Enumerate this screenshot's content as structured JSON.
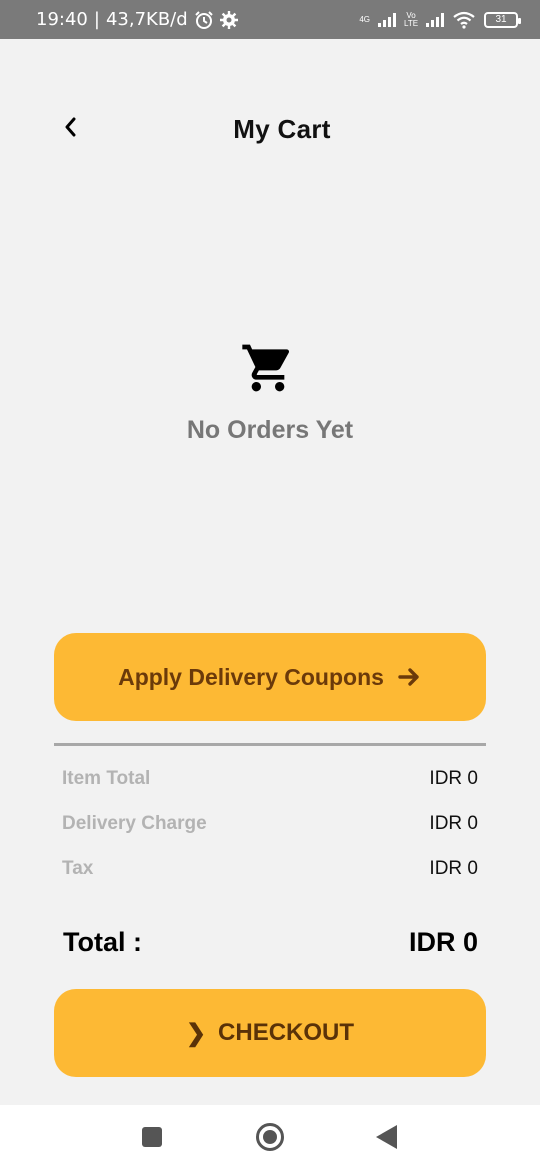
{
  "status_bar": {
    "time": "19:40",
    "separator": "|",
    "speed": "43,7KB/d",
    "network_tag": "4G",
    "volte_tag": "Vo LTE",
    "battery": "31",
    "icons": [
      "alarm-icon",
      "settings-gear-icon",
      "signal-icon",
      "wifi-icon",
      "battery-icon"
    ]
  },
  "header": {
    "title": "My Cart",
    "back_icon": "chevron-left-icon"
  },
  "empty_state": {
    "icon": "shopping-cart-icon",
    "message": "No Orders Yet"
  },
  "coupon": {
    "label": "Apply Delivery Coupons",
    "icon": "arrow-right-icon"
  },
  "summary": {
    "rows": [
      {
        "label": "Item Total",
        "value": "IDR 0"
      },
      {
        "label": "Delivery Charge",
        "value": "IDR 0"
      },
      {
        "label": "Tax",
        "value": "IDR 0"
      }
    ],
    "total_label": "Total :",
    "total_value": "IDR 0"
  },
  "checkout": {
    "chevron": "❯",
    "label": "CHECKOUT"
  },
  "colors": {
    "accent": "#fdb934",
    "background": "#f2f2f2",
    "status_bar": "#7a7a7a"
  }
}
